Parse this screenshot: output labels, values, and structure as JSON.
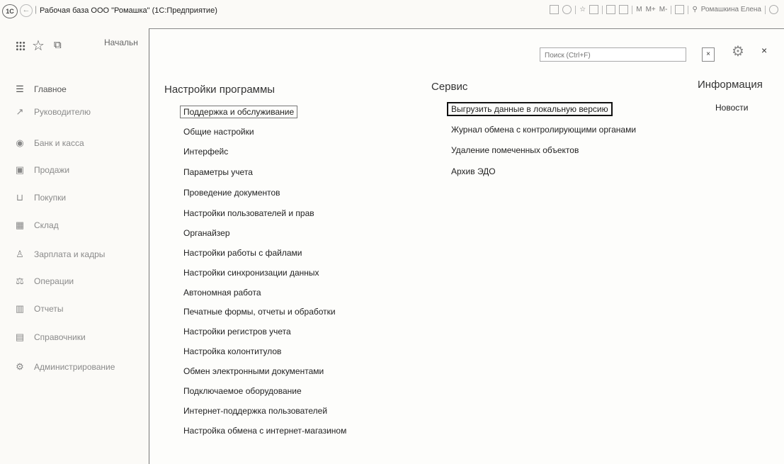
{
  "titlebar": {
    "logo": "1С",
    "app_title": "Рабочая база ООО \"Ромашка\"  (1С:Предприятие)",
    "m_buttons": [
      "M",
      "M+",
      "M-"
    ],
    "user": "Ромашкина Елена"
  },
  "left_toolbar": {
    "start_tab": "Начальн"
  },
  "sidebar": {
    "items": [
      {
        "label": "Главное",
        "icon": "list-icon"
      },
      {
        "label": "Руководителю",
        "icon": "chart-icon"
      },
      {
        "label": "Банк и касса",
        "icon": "coin-icon"
      },
      {
        "label": "Продажи",
        "icon": "store-icon"
      },
      {
        "label": "Покупки",
        "icon": "cart-icon"
      },
      {
        "label": "Склад",
        "icon": "warehouse-icon"
      },
      {
        "label": "Зарплата и кадры",
        "icon": "person-icon"
      },
      {
        "label": "Операции",
        "icon": "operations-icon"
      },
      {
        "label": "Отчеты",
        "icon": "report-icon"
      },
      {
        "label": "Справочники",
        "icon": "book-icon"
      },
      {
        "label": "Администрирование",
        "icon": "admin-gear-icon"
      }
    ]
  },
  "search": {
    "placeholder": "Поиск (Ctrl+F)",
    "clear": "×"
  },
  "close": "×",
  "columns": {
    "settings": {
      "header": "Настройки программы",
      "items": [
        "Поддержка и обслуживание",
        "Общие настройки",
        "Интерфейс",
        "Параметры учета",
        "Проведение документов",
        "Настройки пользователей и прав",
        "Органайзер",
        "Настройки работы с файлами",
        "Настройки синхронизации данных",
        "Автономная работа",
        "Печатные формы, отчеты и обработки",
        "Настройки регистров учета",
        "Настройка колонтитулов",
        "Обмен электронными документами",
        "Подключаемое оборудование",
        "Интернет-поддержка пользователей",
        "Настройка обмена с интернет-магазином"
      ]
    },
    "service": {
      "header": "Сервис",
      "items": [
        "Выгрузить данные в локальную версию",
        "Журнал обмена с контролирующими органами",
        "Удаление помеченных объектов",
        "Архив ЭДО"
      ]
    },
    "info": {
      "header": "Информация",
      "items": [
        "Новости"
      ]
    }
  }
}
